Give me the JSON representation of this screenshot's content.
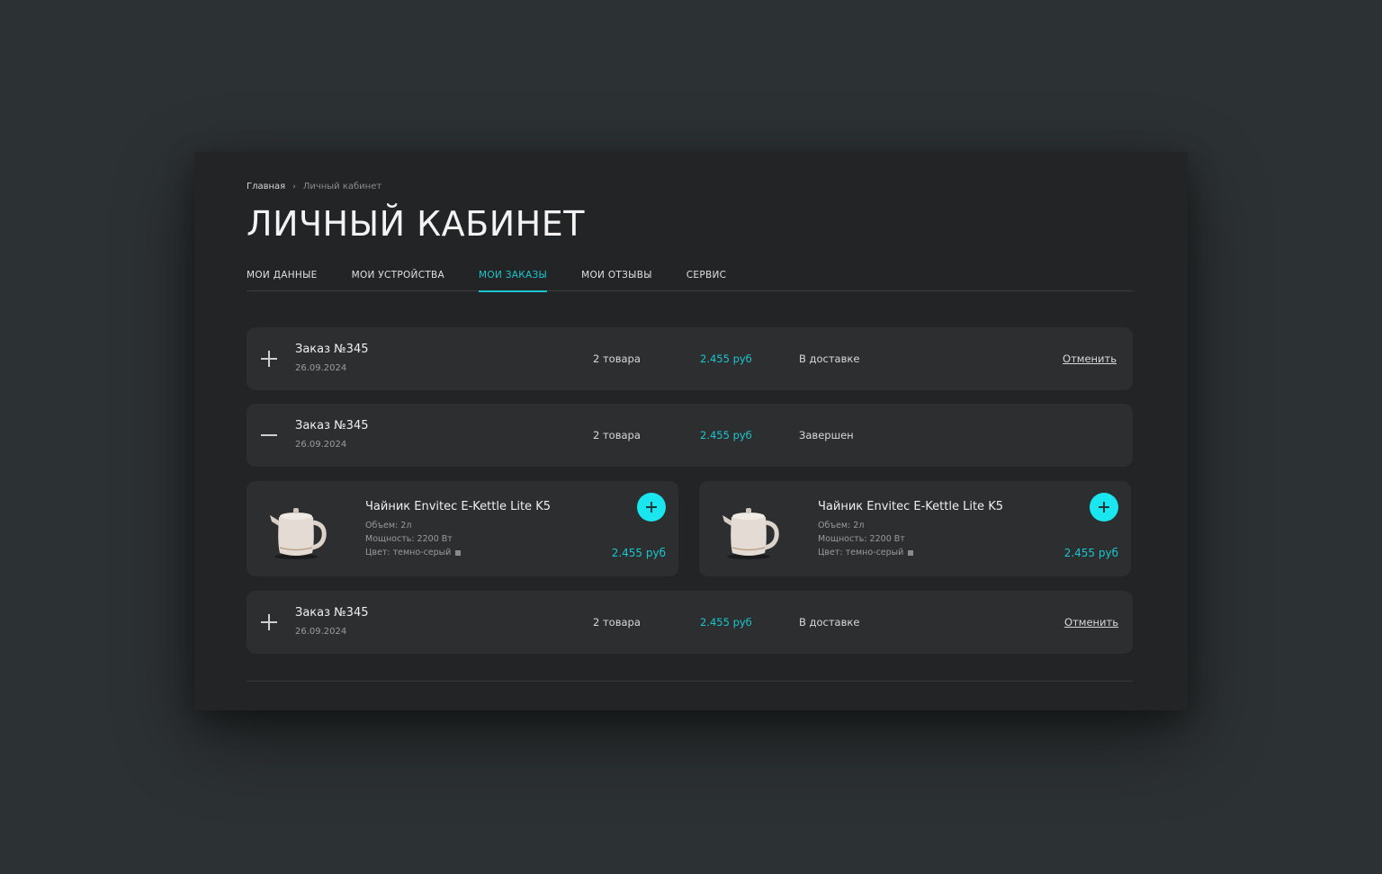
{
  "breadcrumb": {
    "home": "Главная",
    "separator": "›",
    "current": "Личный кабинет"
  },
  "page_title": "ЛИЧНЫЙ КАБИНЕТ",
  "tabs": [
    {
      "label": "МОИ ДАННЫЕ",
      "active": false
    },
    {
      "label": "МОИ УСТРОЙСТВА",
      "active": false
    },
    {
      "label": "МОИ ЗАКАЗЫ",
      "active": true
    },
    {
      "label": "МОИ ОТЗЫВЫ",
      "active": false
    },
    {
      "label": "СЕРВИС",
      "active": false
    }
  ],
  "orders": [
    {
      "title": "Заказ №345",
      "date": "26.09.2024",
      "count": "2 товара",
      "price": "2.455 руб",
      "status": "В доставке",
      "cancel": "Отменить",
      "expanded": false
    },
    {
      "title": "Заказ №345",
      "date": "26.09.2024",
      "count": "2 товара",
      "price": "2.455 руб",
      "status": "Завершен",
      "cancel": "",
      "expanded": true
    },
    {
      "title": "Заказ №345",
      "date": "26.09.2024",
      "count": "2 товара",
      "price": "2.455 руб",
      "status": "В доставке",
      "cancel": "Отменить",
      "expanded": false
    }
  ],
  "products": [
    {
      "name": "Чайник Envitec E-Kettle Lite K5",
      "volume": "Объем: 2л",
      "power": "Мощность: 2200 Вт",
      "color": "Цвет: темно-серый",
      "price": "2.455 руб"
    },
    {
      "name": "Чайник Envitec E-Kettle Lite K5",
      "volume": "Объем: 2л",
      "power": "Мощность: 2200 Вт",
      "color": "Цвет: темно-серый",
      "price": "2.455 руб"
    }
  ],
  "colors": {
    "accent": "#19c6cf",
    "button": "#19e6ee",
    "panel": "#232425",
    "card": "#2d2e30",
    "background": "#2c3133"
  },
  "icons": {
    "expand": "plus-icon",
    "collapse": "minus-icon",
    "add": "plus-icon",
    "breadcrumb": "chevron-right-icon"
  }
}
